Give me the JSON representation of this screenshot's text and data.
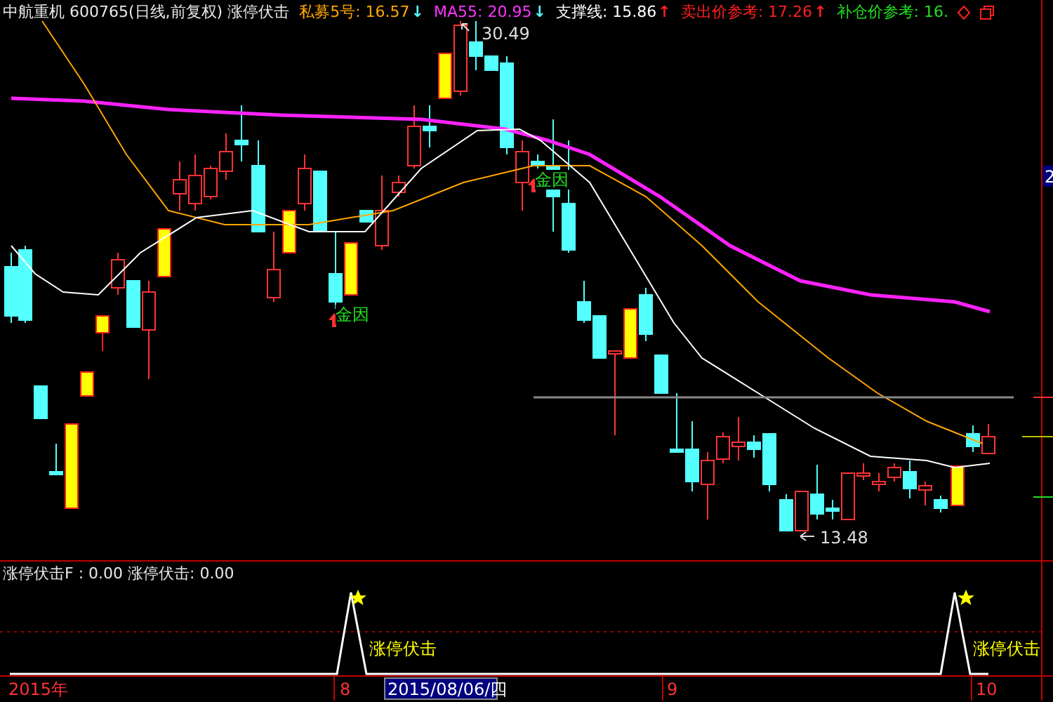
{
  "header": {
    "title": "中航重机 600765(日线,前复权) 涨停伏击",
    "indicators": [
      {
        "label": "私募5号: 16.57",
        "color": "#ffa500",
        "arrow": "↓"
      },
      {
        "label": "MA55: 20.95",
        "color": "#ff33ff",
        "arrow": "↓"
      },
      {
        "label": "支撑线: 15.86",
        "color": "#ffffff",
        "arrow": "↑"
      },
      {
        "label": "卖出价参考: 17.26",
        "color": "#ff2020",
        "arrow": "↑"
      },
      {
        "label": "补仓价参考: 16.",
        "color": "#20e020"
      }
    ]
  },
  "main_chart": {
    "high_label": "30.49",
    "low_label": "13.48",
    "tags": [
      "金因",
      "金因"
    ],
    "axis_label": "2"
  },
  "indicator_panel": {
    "values": "涨停伏击F : 0.00 涨停伏击: 0.00",
    "signals": [
      "涨停伏击",
      "涨停伏击"
    ]
  },
  "date_axis": [
    {
      "label": "2015年",
      "selected": false
    },
    {
      "label": "8",
      "selected": false
    },
    {
      "label": "2015/08/06/四",
      "selected": true
    },
    {
      "label": "9",
      "selected": false
    },
    {
      "label": "10",
      "selected": false
    }
  ]
}
